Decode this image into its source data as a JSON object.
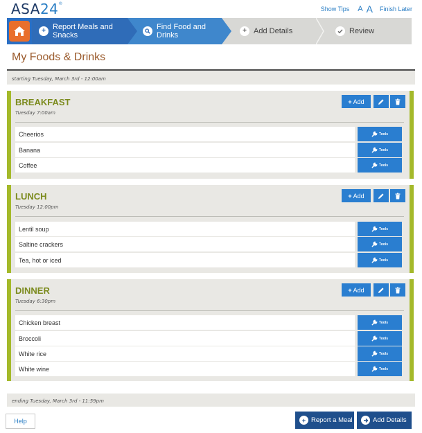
{
  "header": {
    "logo_text": "ASA",
    "logo_num": "24",
    "logo_mark": "®",
    "links": {
      "show_tips": "Show Tips",
      "font_small": "A",
      "font_large": "A",
      "finish_later": "Finish Later"
    }
  },
  "steps": [
    {
      "label": "Report Meals and Snacks",
      "state": "done"
    },
    {
      "label": "Find Food and Drinks",
      "state": "current"
    },
    {
      "label": "Add Details",
      "state": "pending"
    },
    {
      "label": "Review",
      "state": "pending"
    }
  ],
  "page_title": "My Foods & Drinks",
  "day_start": "starting Tuesday, March 3rd - 12:00am",
  "day_end": "ending Tuesday, March 3rd - 11:59pm",
  "buttons": {
    "add": "Add",
    "tools": "Tools"
  },
  "meals": [
    {
      "name": "BREAKFAST",
      "time": "Tuesday 7:00am",
      "items": [
        "Cheerios",
        "Banana",
        "Coffee"
      ]
    },
    {
      "name": "LUNCH",
      "time": "Tuesday 12:00pm",
      "items": [
        "Lentil soup",
        "Saltine crackers",
        "Tea, hot or iced"
      ]
    },
    {
      "name": "DINNER",
      "time": "Tuesday 6:30pm",
      "items": [
        "Chicken breast",
        "Broccoli",
        "White rice",
        "White wine"
      ]
    }
  ],
  "footer": {
    "help": "Help",
    "report_meal": "Report a Meal",
    "add_details": "Add Details"
  },
  "colors": {
    "meal_accent": "#a4b92a",
    "primary_blue": "#2a7ed0",
    "home_orange": "#e96f2c",
    "title_brown": "#9a5a2c"
  }
}
